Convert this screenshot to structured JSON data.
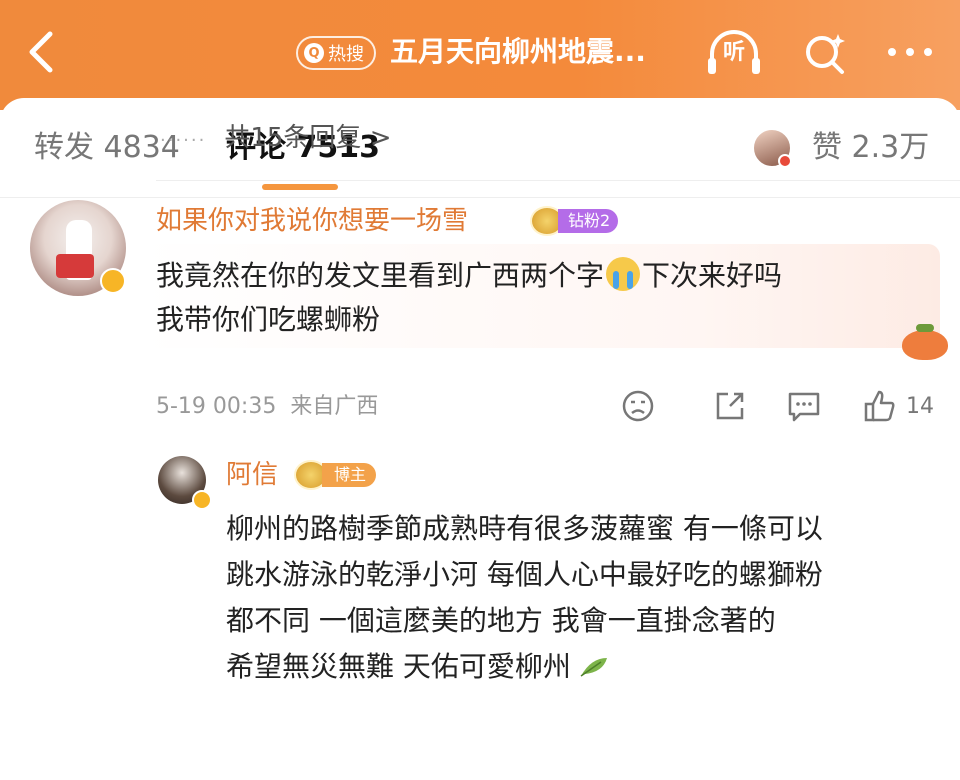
{
  "header": {
    "hot_badge": "热搜",
    "title": "五月天向柳州地震...",
    "listen_label": "听"
  },
  "tabs": {
    "repost": "转发 4834",
    "comment": "评论 7513",
    "likes": "赞 2.3万"
  },
  "replies_link": "共15条回复 >",
  "comment": {
    "username": "如果你对我说你想要一场雪",
    "fan_badge": "钻粉2",
    "text_part1": "我竟然在你的发文里看到广西两个字",
    "text_part2": "下次来好吗",
    "text_line2": "我带你们吃螺蛳粉",
    "timestamp": "5-19 00:35",
    "source": "来自广西",
    "like_count": "14"
  },
  "reply": {
    "username": "阿信",
    "author_badge": "博主",
    "lines": [
      "柳州的路樹季節成熟時有很多菠蘿蜜  有一條可以",
      "跳水游泳的乾淨小河  每個人心中最好吃的螺獅粉",
      "都不同  一個這麼美的地方  我會一直掛念著的",
      "希望無災無難  天佑可愛柳州"
    ]
  },
  "icons": {
    "back": "back-arrow-icon",
    "listen": "headphones-icon",
    "search": "search-icon",
    "more": "more-icon",
    "dislike": "frown-icon",
    "share": "share-icon",
    "reply": "comment-icon",
    "like": "thumbs-up-icon",
    "leaf": "leaf-icon"
  },
  "colors": {
    "header_orange": "#f08a3c",
    "username_orange": "#e07a35",
    "tab_underline": "#f5963e",
    "fan_badge_purple": "#b46ce8"
  }
}
